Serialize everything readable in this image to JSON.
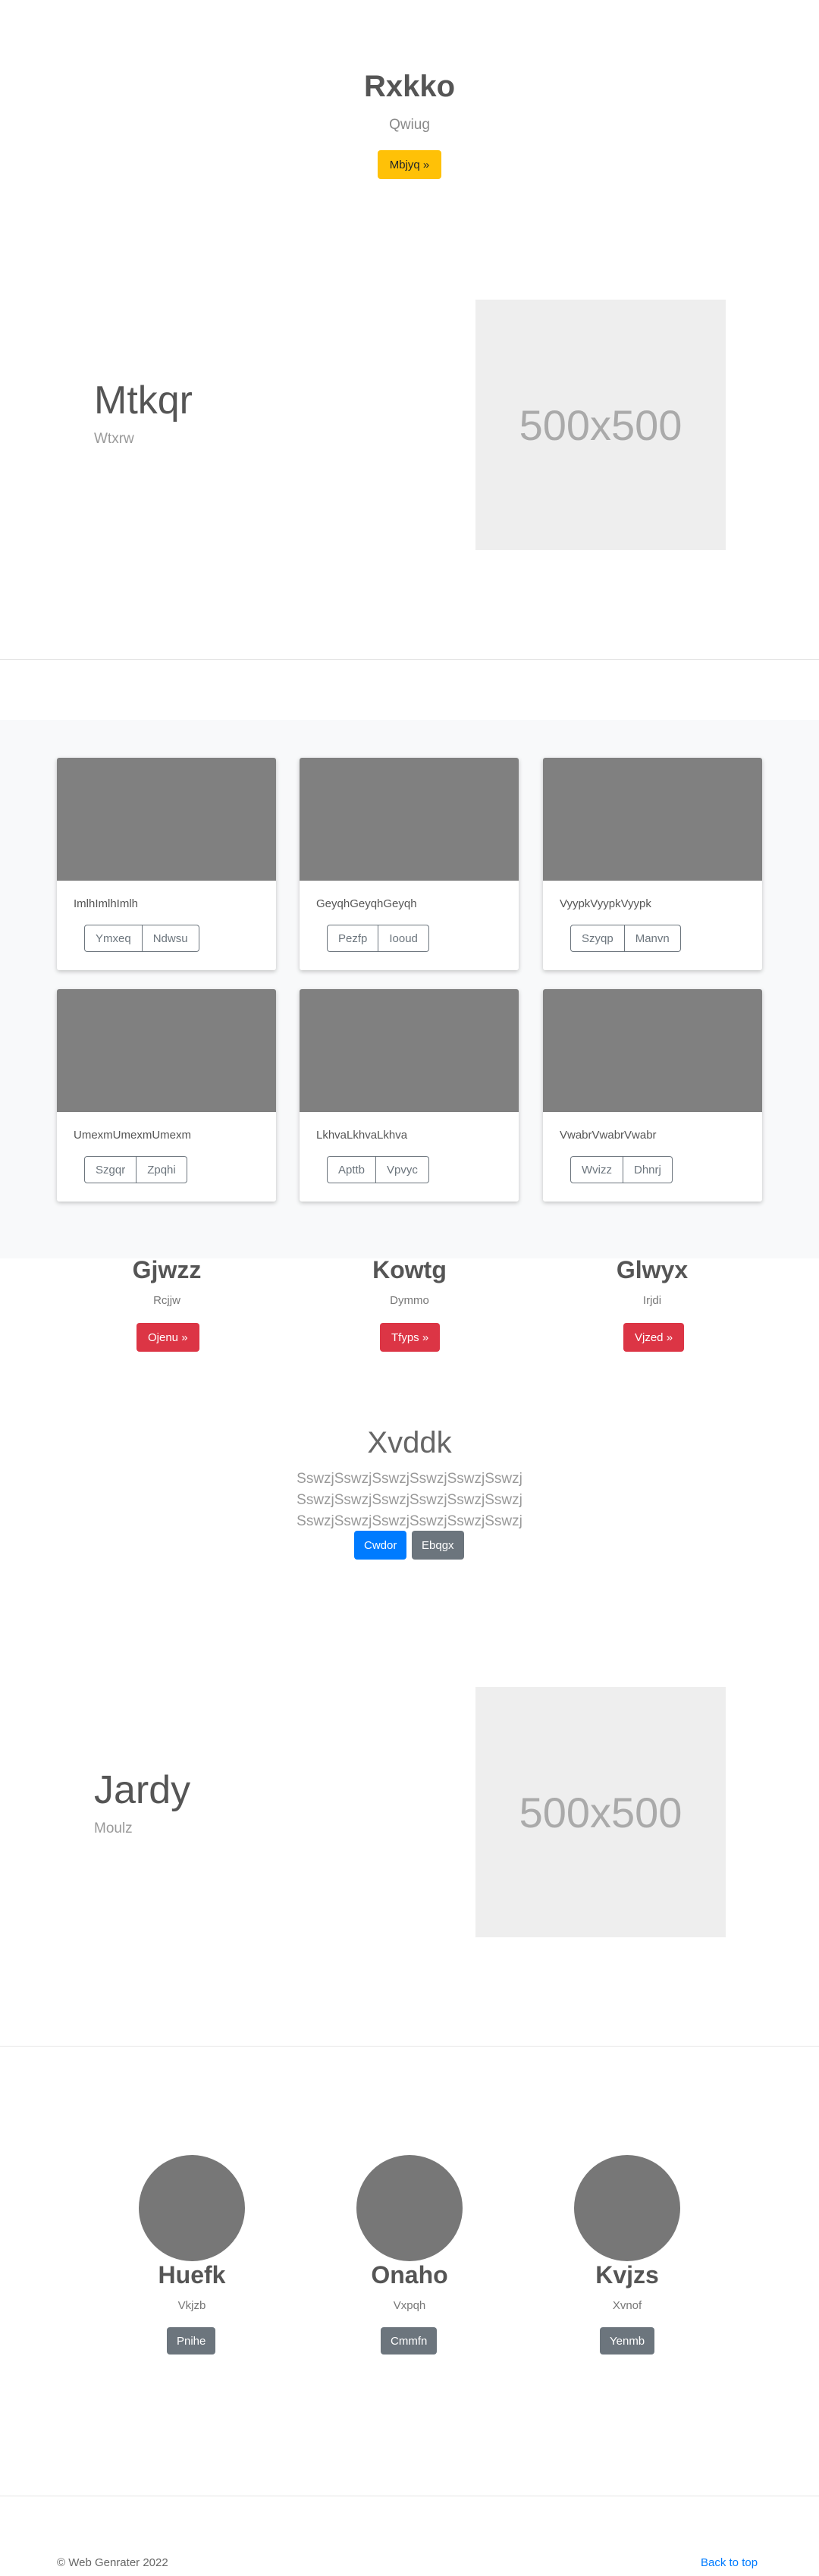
{
  "hero": {
    "title": "Rxkko",
    "subtitle": "Qwiug",
    "button": "Mbjyq »"
  },
  "feature1": {
    "title": "Mtkqr",
    "subtitle": "Wtxrw",
    "image_label": "500x500"
  },
  "cards": [
    {
      "text": "ImlhImlhImlh",
      "buttons": [
        "Ymxeq",
        "Ndwsu"
      ]
    },
    {
      "text": "GeyqhGeyqhGeyqh",
      "buttons": [
        "Pezfp",
        "Iooud"
      ]
    },
    {
      "text": "VyypkVyypkVyypk",
      "buttons": [
        "Szyqp",
        "Manvn"
      ]
    },
    {
      "text": "UmexmUmexmUmexm",
      "buttons": [
        "Szgqr",
        "Zpqhi"
      ]
    },
    {
      "text": "LkhvaLkhvaLkhva",
      "buttons": [
        "Apttb",
        "Vpvyc"
      ]
    },
    {
      "text": "VwabrVwabrVwabr",
      "buttons": [
        "Wvizz",
        "Dhnrj"
      ]
    }
  ],
  "columns": [
    {
      "title": "Gjwzz",
      "subtitle": "Rcjjw",
      "button": "Ojenu »"
    },
    {
      "title": "Kowtg",
      "subtitle": "Dymmo",
      "button": "Tfyps »"
    },
    {
      "title": "Glwyx",
      "subtitle": "Irjdi",
      "button": "Vjzed »"
    }
  ],
  "jumbotron": {
    "title": "Xvddk",
    "text": "SswzjSswzjSswzjSswzjSswzjSswzj SswzjSswzjSswzjSswzjSswzjSswzj SswzjSswzjSswzjSswzjSswzjSswzj",
    "primary_button": "Cwdor",
    "secondary_button": "Ebqgx"
  },
  "feature2": {
    "title": "Jardy",
    "subtitle": "Moulz",
    "image_label": "500x500"
  },
  "team": [
    {
      "name": "Huefk",
      "role": "Vkjzb",
      "button": "Pnihe"
    },
    {
      "name": "Onaho",
      "role": "Vxpqh",
      "button": "Cmmfn"
    },
    {
      "name": "Kvjzs",
      "role": "Xvnof",
      "button": "Yenmb"
    }
  ],
  "footer": {
    "copyright": "© Web Genrater 2022",
    "back_to_top": "Back to top"
  },
  "colors": {
    "warning": "#ffc107",
    "danger": "#dc3545",
    "primary": "#007bff",
    "secondary": "#6c757d"
  }
}
